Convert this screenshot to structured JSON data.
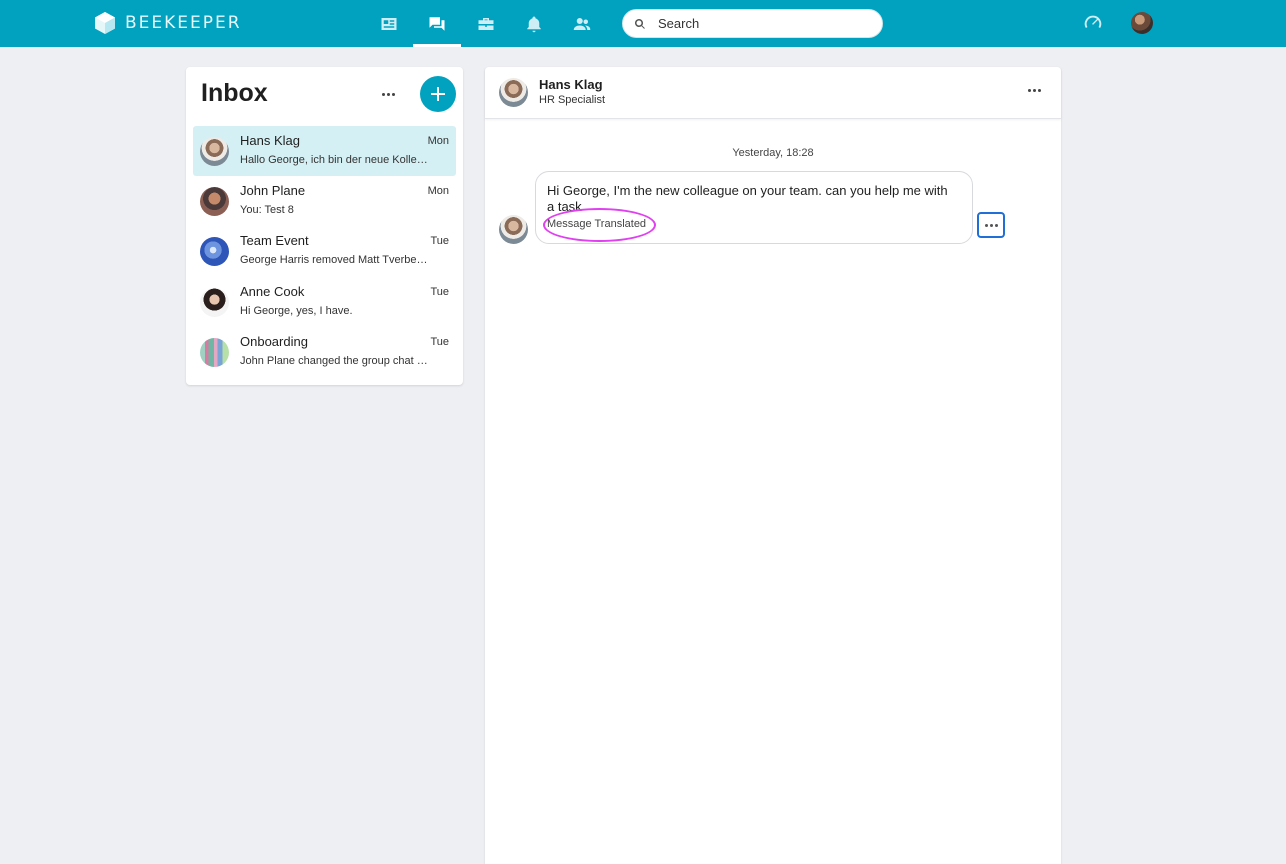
{
  "app": {
    "brand": "BEEKEEPER",
    "accent_color": "#00a2bf"
  },
  "topbar": {
    "nav": [
      {
        "icon": "news-feed-icon",
        "active": false
      },
      {
        "icon": "chat-icon",
        "active": true
      },
      {
        "icon": "toolbox-icon",
        "active": false
      },
      {
        "icon": "bell-icon",
        "active": false
      },
      {
        "icon": "people-icon",
        "active": false
      }
    ],
    "search": {
      "placeholder": "Search",
      "value": ""
    },
    "right_icons": [
      "gauge-icon",
      "user-avatar"
    ]
  },
  "inbox": {
    "title": "Inbox",
    "conversations": [
      {
        "name": "Hans Klag",
        "day": "Mon",
        "preview": "Hallo George, ich bin der neue Kolle…",
        "selected": true
      },
      {
        "name": "John Plane",
        "day": "Mon",
        "preview": "You: Test 8",
        "selected": false
      },
      {
        "name": "Team Event",
        "day": "Tue",
        "preview": "George Harris removed Matt Tverbe…",
        "selected": false
      },
      {
        "name": "Anne Cook",
        "day": "Tue",
        "preview": "Hi George, yes, I have.",
        "selected": false
      },
      {
        "name": "Onboarding",
        "day": "Tue",
        "preview": "John Plane changed the group chat …",
        "selected": false
      }
    ]
  },
  "chat": {
    "contact_name": "Hans Klag",
    "contact_role": "HR Specialist",
    "date_separator": "Yesterday, 18:28",
    "message": {
      "text": "Hi George, I'm the new colleague on your team. can you help me with a task",
      "status": "Message Translated",
      "highlight_color": "#e040f0"
    }
  }
}
